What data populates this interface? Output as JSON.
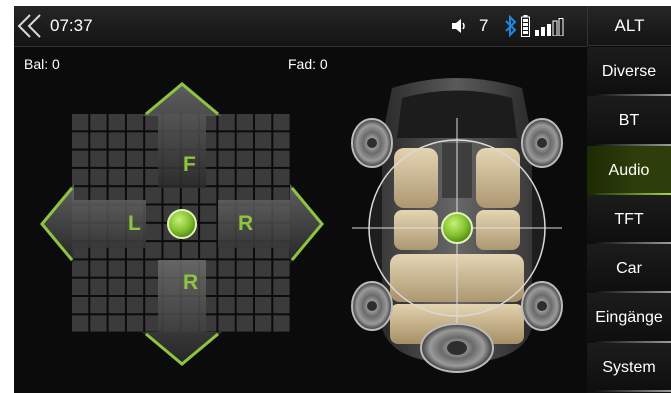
{
  "status_bar": {
    "back_icon": "double-chevron-left-icon",
    "time": "07:37",
    "volume_icon": "speaker-icon",
    "volume": "7",
    "bluetooth_icon": "bluetooth-icon",
    "battery_icon": "battery-icon",
    "signal_icon": "signal-strength-icon",
    "alt_button": "ALT"
  },
  "sidebar": {
    "items": [
      {
        "label": "Diverse",
        "active": false
      },
      {
        "label": "BT",
        "active": false
      },
      {
        "label": "Audio",
        "active": true
      },
      {
        "label": "TFT",
        "active": false
      },
      {
        "label": "Car",
        "active": false
      },
      {
        "label": "Eingänge",
        "active": false
      },
      {
        "label": "System",
        "active": false
      }
    ]
  },
  "balance": {
    "bal_label": "Bal: 0",
    "fad_label": "Fad: 0",
    "front_letter": "F",
    "rear_letter": "R",
    "left_letter": "L",
    "right_letter": "R"
  },
  "colors": {
    "accent_green": "#8cc63f",
    "background": "#0b0b0b",
    "bluetooth_blue": "#1e88e5"
  }
}
